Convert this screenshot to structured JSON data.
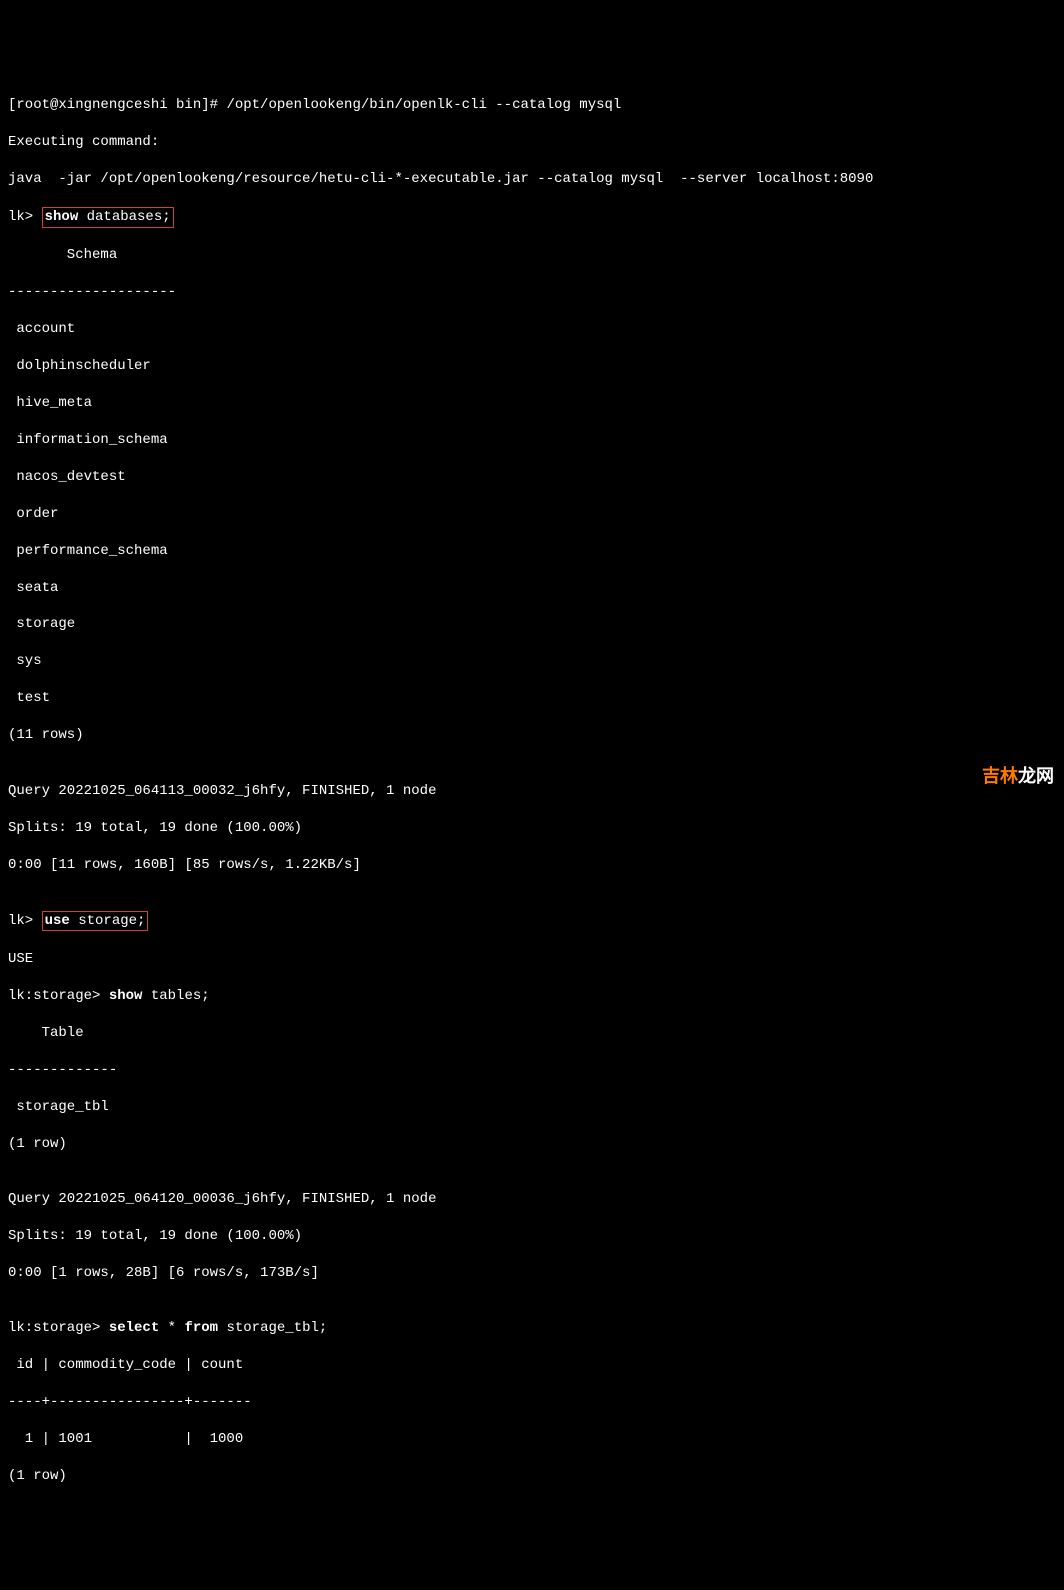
{
  "shell_prompt": "[root@xingnengceshi bin]# ",
  "shell_cmd": "/opt/openlookeng/bin/openlk-cli --catalog mysql",
  "executing_line": "Executing command:",
  "java_line": "java  -jar /opt/openlookeng/resource/hetu-cli-*-executable.jar --catalog mysql  --server localhost:8090",
  "lk_prompt": "lk> ",
  "cmd_show_databases_pre": "show",
  "cmd_show_databases_post": " databases;",
  "schema_header": "       Schema",
  "schema_divider": "--------------------",
  "schema_rows": [
    " account",
    " dolphinscheduler",
    " hive_meta",
    " information_schema",
    " nacos_devtest",
    " order",
    " performance_schema",
    " seata",
    " storage",
    " sys",
    " test"
  ],
  "schema_rowcount": "(11 rows)",
  "blank": "",
  "query1_line1": "Query 20221025_064113_00032_j6hfy, FINISHED, 1 node",
  "query1_line2": "Splits: 19 total, 19 done (100.00%)",
  "query1_line3": "0:00 [11 rows, 160B] [85 rows/s, 1.22KB/s]",
  "cmd_use_pre": "use",
  "cmd_use_post": " storage;",
  "use_echo": "USE",
  "lk_storage_prompt": "lk:storage> ",
  "cmd_show_tables_pre": "show",
  "cmd_show_tables_post": " tables;",
  "tables_header": "    Table",
  "tables_divider": "-------------",
  "tables_row": " storage_tbl",
  "tables_rowcount": "(1 row)",
  "query2_line1": "Query 20221025_064120_00036_j6hfy, FINISHED, 1 node",
  "query2_line2": "Splits: 19 total, 19 done (100.00%)",
  "query2_line3": "0:00 [1 rows, 28B] [6 rows/s, 173B/s]",
  "cmd_select_pre": "select",
  "cmd_select_mid1": " * ",
  "cmd_select_kw2": "from",
  "cmd_select_post": " storage_tbl;",
  "select_header": " id | commodity_code | count",
  "select_divider": "----+----------------+-------",
  "select_row1": "  1 | 1001           |  1000",
  "select_row2": "(1 row)",
  "watermark_part1": "吉林",
  "watermark_part2": "龙网"
}
